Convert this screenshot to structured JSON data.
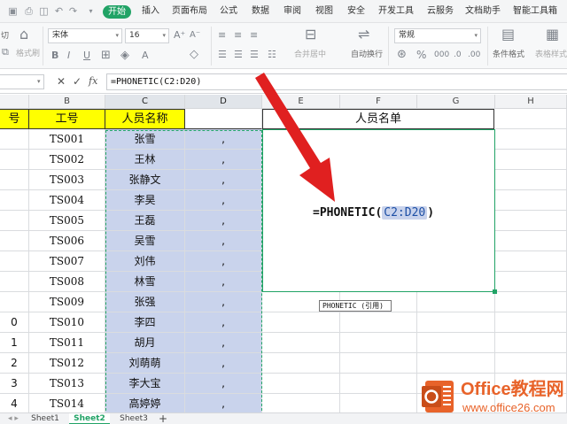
{
  "menu": {
    "start": "开始",
    "items": [
      "插入",
      "页面布局",
      "公式",
      "数据",
      "审阅",
      "视图",
      "安全",
      "开发工具",
      "云服务",
      "文档助手",
      "智能工具箱"
    ]
  },
  "ribbon": {
    "cut_partial": "切",
    "format_painter_partial": "格式刷",
    "font_name": "宋体",
    "font_size": "16",
    "merge_center": "合并居中",
    "wrap_text": "自动换行",
    "number_format": "常规",
    "conditional_format": "条件格式",
    "table_style": "表格样式"
  },
  "formula_bar": {
    "fx": "fx",
    "formula": "=PHONETIC(C2:D20)"
  },
  "columns": [
    "B",
    "C",
    "D",
    "E",
    "F",
    "G",
    "H"
  ],
  "headers": {
    "a_partial": "号",
    "employee_id": "工号",
    "name": "人员名称",
    "merged_title": "人员名单"
  },
  "rows": [
    {
      "a": "",
      "id": "TS001",
      "name": "张雪",
      "sep": ","
    },
    {
      "a": "",
      "id": "TS002",
      "name": "王林",
      "sep": ","
    },
    {
      "a": "",
      "id": "TS003",
      "name": "张静文",
      "sep": ","
    },
    {
      "a": "",
      "id": "TS004",
      "name": "李昊",
      "sep": ","
    },
    {
      "a": "",
      "id": "TS005",
      "name": "王磊",
      "sep": ","
    },
    {
      "a": "",
      "id": "TS006",
      "name": "吴雪",
      "sep": ","
    },
    {
      "a": "",
      "id": "TS007",
      "name": "刘伟",
      "sep": ","
    },
    {
      "a": "",
      "id": "TS008",
      "name": "林雪",
      "sep": ","
    },
    {
      "a": "",
      "id": "TS009",
      "name": "张强",
      "sep": ","
    },
    {
      "a": "0",
      "id": "TS010",
      "name": "李四",
      "sep": ","
    },
    {
      "a": "1",
      "id": "TS011",
      "name": "胡月",
      "sep": ","
    },
    {
      "a": "2",
      "id": "TS012",
      "name": "刘萌萌",
      "sep": ","
    },
    {
      "a": "3",
      "id": "TS013",
      "name": "李大宝",
      "sep": ","
    },
    {
      "a": "4",
      "id": "TS014",
      "name": "高婷婷",
      "sep": ","
    }
  ],
  "edit": {
    "func": "=PHONETIC(",
    "ref": "C2:D20",
    "close": ")",
    "tooltip": "PHONETIC (引用)"
  },
  "sheets": [
    "Sheet1",
    "Sheet2",
    "Sheet3"
  ],
  "active_sheet": "Sheet2",
  "watermark": {
    "title": "Office教程网",
    "url": "www.office26.com"
  },
  "colors": {
    "accent": "#21a366",
    "header_fill": "#ffff00",
    "selection_fill": "#c9d3ec",
    "arrow": "#e02020",
    "watermark": "#e8632a"
  }
}
